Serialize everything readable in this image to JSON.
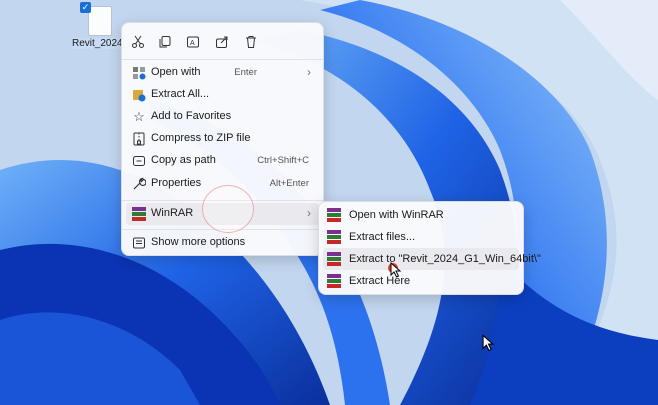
{
  "desktop": {
    "file_label": "Revit_2024_...",
    "wallpaper_colors": {
      "sky": "#bcd1ee",
      "bloom_dark": "#0a3ec4",
      "bloom_mid": "#1f63e6",
      "bloom_light": "#5ea3f5"
    }
  },
  "context_menu": {
    "toolbar": [
      {
        "icon": "cut-icon",
        "label": "Cut"
      },
      {
        "icon": "copy-icon",
        "label": "Copy"
      },
      {
        "icon": "rename-icon",
        "label": "Rename"
      },
      {
        "icon": "share-icon",
        "label": "Share"
      },
      {
        "icon": "delete-icon",
        "label": "Delete"
      }
    ],
    "items": [
      {
        "label": "Open with",
        "shortcut": "Enter",
        "icon": "open-with-icon",
        "arrow": "›"
      },
      {
        "label": "Extract All...",
        "icon": "extract-all-icon"
      },
      {
        "label": "Add to Favorites",
        "icon": "star-icon"
      },
      {
        "label": "Compress to ZIP file",
        "icon": "zip-icon"
      },
      {
        "label": "Copy as path",
        "shortcut": "Ctrl+Shift+C",
        "icon": "copy-path-icon"
      },
      {
        "label": "Properties",
        "shortcut": "Alt+Enter",
        "icon": "wrench-icon"
      },
      {
        "label": "WinRAR",
        "icon": "winrar-icon",
        "arrow": "›"
      },
      {
        "label": "Show more options",
        "icon": "more-options-icon"
      }
    ]
  },
  "winrar_submenu": {
    "items": [
      {
        "label": "Open with WinRAR"
      },
      {
        "label": "Extract files..."
      },
      {
        "label": "Extract to \"Revit_2024_G1_Win_64bit\\\""
      },
      {
        "label": "Extract Here"
      }
    ]
  }
}
